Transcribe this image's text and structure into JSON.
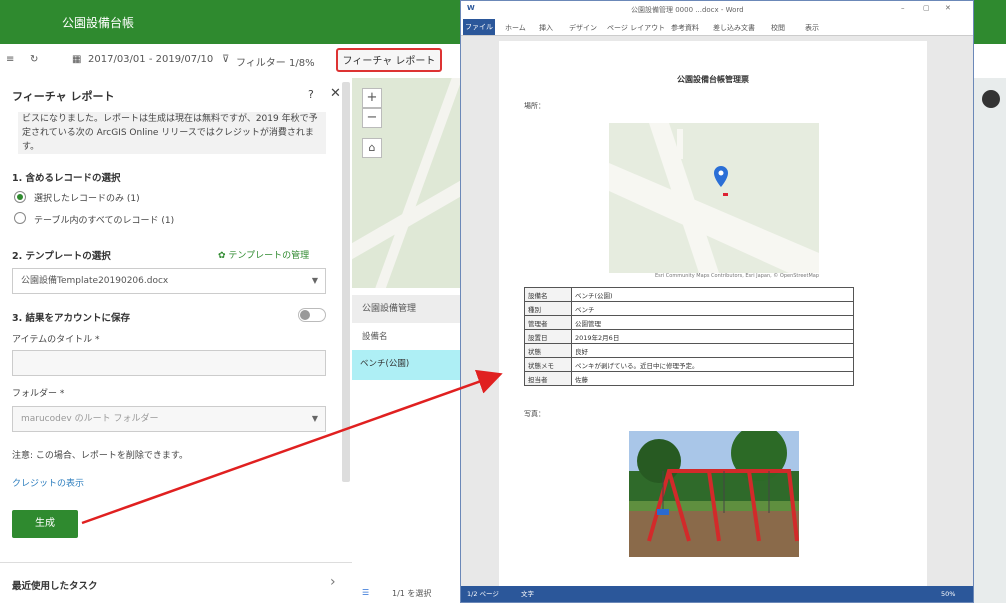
{
  "app": {
    "title": "公園設備台帳"
  },
  "toolbar": {
    "date_range": "2017/03/01 - 2019/07/10",
    "filter_label": "フィルター 1/8%",
    "report_button": "フィーチャ レポート"
  },
  "panel": {
    "header": "フィーチャ レポート",
    "notice": "ビスになりました。レポートは生成は現在は無料ですが、2019 年秋で予定されている次の ArcGIS Online リリースではクレジットが消費されます。",
    "section1_title": "1. 含めるレコードの選択",
    "radio1": "選択したレコードのみ (1)",
    "radio2": "テーブル内のすべてのレコード (1)",
    "section2_title": "2. テンプレートの選択",
    "template_manage": "テンプレートの管理",
    "template_value": "公園設備Template20190206.docx",
    "section3_title": "3. 結果をアカウントに保存",
    "item_title_label": "アイテムのタイトル *",
    "item_title_value": "",
    "folder_label": "フォルダー *",
    "folder_value": "marucodev のルート フォルダー",
    "note": "注意: この場合、レポートを削除できます。",
    "credit_link": "クレジットの表示",
    "create_button": "生成",
    "recent_tasks": "最近使用したタスク"
  },
  "attr_table": {
    "header": "公園設備管理",
    "col": "設備名",
    "row_value": "ベンチ(公園)"
  },
  "word": {
    "title": "公園設備管理 0000 ...docx - Word",
    "tabs": [
      "ファイル",
      "ホーム",
      "挿入",
      "デザイン",
      "ページ レイアウト",
      "参考資料",
      "差し込み文書",
      "校閲",
      "表示"
    ],
    "status_left": "1/2 ページ",
    "status_words": "文字",
    "status_zoom": "50%",
    "doc_title": "公園設備台帳管理票",
    "location_label": "場所：",
    "map_attribution": "Esri Community Maps Contributors, Esri Japan, © OpenStreetMap",
    "photo_label": "写真：",
    "table": [
      [
        "設備名",
        "ベンチ(公園)"
      ],
      [
        "種別",
        "ベンチ"
      ],
      [
        "管理者",
        "公園管理"
      ],
      [
        "設置日",
        "2019年2月6日"
      ],
      [
        "状態",
        "良好"
      ],
      [
        "状態メモ",
        "ペンキが剥げている。近日中に修理予定。"
      ],
      [
        "担当者",
        "佐藤"
      ]
    ]
  },
  "bottom": {
    "page_info": "1/1 を選択"
  },
  "colors": {
    "brand_green": "#2f8a2f",
    "word_blue": "#2b579a",
    "highlight": "#aeeff5",
    "arrow": "#e02020"
  }
}
